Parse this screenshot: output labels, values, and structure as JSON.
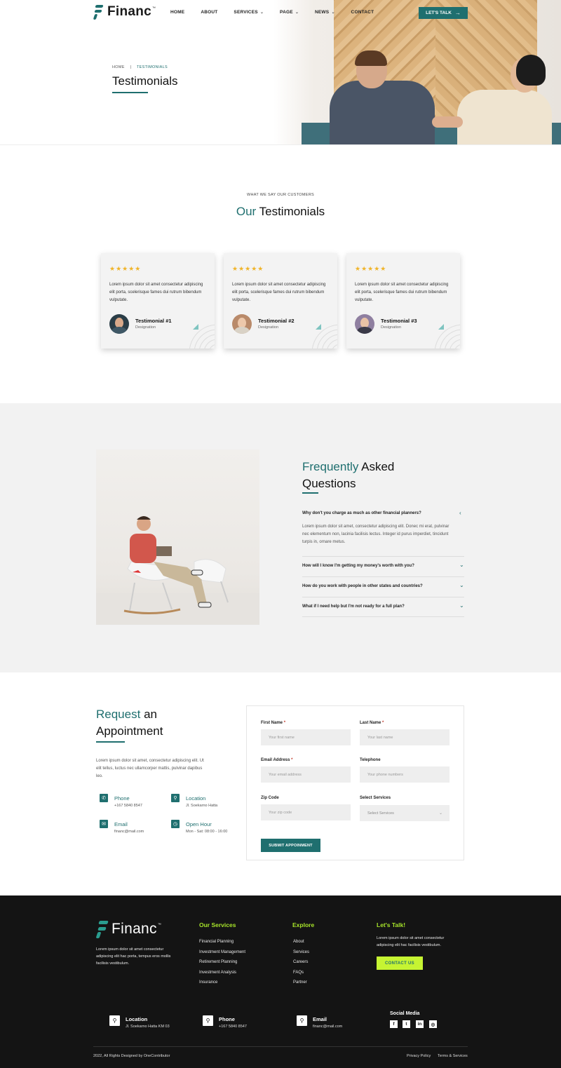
{
  "header": {
    "logo": "Financ",
    "nav": {
      "home": "HOME",
      "about": "ABOUT",
      "services": "SERVICES",
      "page": "PAGE",
      "news": "NEWS",
      "contact": "CONTACT"
    },
    "cta": "LET'S TALK",
    "breadcrumb": {
      "home": "HOME",
      "sep": "|",
      "current": "TESTIMONIALS"
    },
    "title": "Testimonials"
  },
  "testimonials": {
    "kicker": "WHAT WE SAY OUR CUSTOMERS",
    "title_accent": "Our",
    "title_rest": "Testimonials",
    "cards": [
      {
        "stars": "★★★★★",
        "text": "Lorem ipsum dolor sit amet consectetur adipiscing elit porta, scelerisque fames dui rutrum bibendum vulputate.",
        "name": "Testimonial #1",
        "role": "Designation"
      },
      {
        "stars": "★★★★★",
        "text": "Lorem ipsum dolor sit amet consectetur adipiscing elit porta, scelerisque fames dui rutrum bibendum vulputate.",
        "name": "Testimonial #2",
        "role": "Designation"
      },
      {
        "stars": "★★★★★",
        "text": "Lorem ipsum dolor sit amet consectetur adipiscing elit porta, scelerisque fames dui rutrum bibendum vulputate.",
        "name": "Testimonial #3",
        "role": "Designation"
      }
    ]
  },
  "faq": {
    "title_accent": "Frequently",
    "title_rest1": "Asked",
    "title_rest2": "Questions",
    "items": [
      {
        "q": "Why don't you charge as much as other financial planners?",
        "a": "Lorem ipsum dolor sit amet, consectetur adipiscing elit. Donec mi erat, pulvinar nec elementum non, lacinia facilisis lectus. Integer id purus imperdiet, tincidunt turpis in, ornare metus."
      },
      {
        "q": "How will I know I'm getting my money's worth with you?"
      },
      {
        "q": "How do you work with people in other states and countries?"
      },
      {
        "q": "What if I need help but I'm not ready for a full plan?"
      }
    ]
  },
  "appointment": {
    "title_accent": "Request",
    "title_rest1": "an",
    "title_rest2": "Appointment",
    "text": "Lorem ipsum dolor sit amet, consectetur adipiscing elit. Ut elit tellus, luctus nec ullamcorper mattis, pulvinar dapibus leo.",
    "contacts": {
      "phone": {
        "label": "Phone",
        "value": "+167 5840 8547"
      },
      "location": {
        "label": "Location",
        "value": "Jl. Soekarno Hatta"
      },
      "email": {
        "label": "Email",
        "value": "financ@mail.com"
      },
      "hours": {
        "label": "Open Hour",
        "value": "Mon - Sat: 08:00 - 16:00"
      }
    },
    "form": {
      "first_name": {
        "label": "First Name",
        "req": "*",
        "placeholder": "Your first name"
      },
      "last_name": {
        "label": "Last Name",
        "req": "*",
        "placeholder": "Your last name"
      },
      "email": {
        "label": "Email Address",
        "req": "*",
        "placeholder": "Your email address"
      },
      "phone": {
        "label": "Telephone",
        "placeholder": "Your phone numbers"
      },
      "zip": {
        "label": "Zip Code",
        "placeholder": "Your zip code"
      },
      "service": {
        "label": "Select Services",
        "value": "Select Services"
      },
      "submit": "SUBMIT APPOINMENT"
    }
  },
  "footer": {
    "logo": "Financ",
    "about": "Lorem ipsum dolor sit amet consectetur adipiscing elit hac porta, tempus eros mollis facilisis vestibulum.",
    "services": {
      "title": "Our Services",
      "items": [
        "Financial Planning",
        "Investment Management",
        "Retirement Planning",
        "Investment Analysis",
        "Insurance"
      ]
    },
    "explore": {
      "title": "Explore",
      "items": [
        "About",
        "Services",
        "Careers",
        "FAQs",
        "Partner"
      ]
    },
    "talk": {
      "title": "Let's Talk!",
      "text": "Lorem ipsum dolor sit amet consectetur adipiscing elit hac facilisis vestibulum.",
      "button": "CONTACT US"
    },
    "location": {
      "label": "Location",
      "value": "Jl. Soekarno Hatta KM 03"
    },
    "phone": {
      "label": "Phone",
      "value": "+167 5840 8547"
    },
    "email": {
      "label": "Email",
      "value": "financ@mail.com"
    },
    "social": {
      "title": "Social Media",
      "icons": [
        "facebook-icon",
        "twitter-icon",
        "linkedin-icon",
        "instagram-icon"
      ]
    },
    "copyright": "2022, All Rights Designed by OneContributor",
    "privacy": "Privacy Policy",
    "terms": "Terms & Services"
  },
  "colors": {
    "primary": "#1f6f6f",
    "lime": "#c6f432",
    "star": "#f0b429",
    "footer": "#141414"
  }
}
